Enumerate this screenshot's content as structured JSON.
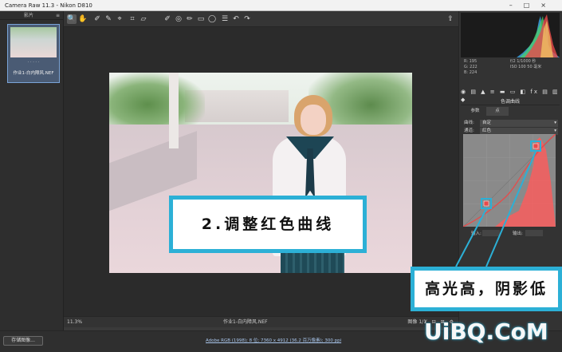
{
  "window": {
    "title": "Camera Raw 11.3 -  Nikon D810",
    "controls": [
      "–",
      "□",
      "×"
    ]
  },
  "filmstrip": {
    "header": "影片",
    "thumb_stars": "· · · · ·",
    "thumb_name": "作业1-白内障风.NEF"
  },
  "toolbar": {
    "icons": [
      "zoom-icon",
      "hand-icon",
      "white-balance-icon",
      "color-sampler-icon",
      "target-adjust-icon",
      "crop-icon",
      "straighten-icon",
      "spot-removal-icon",
      "red-eye-icon",
      "adjustment-brush-icon",
      "graduated-filter-icon",
      "radial-filter-icon",
      "preferences-icon",
      "rotate-ccw-icon",
      "rotate-cw-icon"
    ],
    "glyphs": [
      "🔍",
      "✋",
      "✐",
      "✎",
      "⌖",
      "⌗",
      "▱",
      "✐",
      "◎",
      "✏",
      "▭",
      "◯",
      "☰",
      "↶",
      "↷"
    ],
    "export_glyph": "⇪"
  },
  "bottombar": {
    "zoom": "11.3%",
    "filename": "作业1-白内障风.NEF",
    "pager": "图像 1/1",
    "views": "Y ⊟ ⊞ ⚙"
  },
  "footer": {
    "save_button": "存储图像...",
    "workflow_link": "Adobe RGB (1998); 8 位; 7360 x 4912 (36.2 百万像素); 300 ppi"
  },
  "right_panel": {
    "readout": {
      "rgb_r": "R:    195",
      "rgb_g": "G:    222",
      "rgb_b": "B:    224",
      "exif_1": "f/2    1/1000 秒",
      "exif_2": "ISO 100    50 毫米"
    },
    "panel_icons": "◉ ▤ ▲ ≡ ▬ ▭ ◧ fx ▤ ▥ ◆",
    "section_title": "色调曲线",
    "subtabs": [
      "参数",
      "点"
    ],
    "preset_label": "曲线:",
    "preset_value": "自定",
    "channel_label": "通道:",
    "channel_value": "红色",
    "input_label": "输入:",
    "output_label": "输出:"
  },
  "overlay": {
    "caption": "2.调整红色曲线",
    "annotation": "高光高，阴影低",
    "watermark": "UiBQ.CoM",
    "accent_color": "#2cb0d6",
    "curve_color": "#e84a4a"
  }
}
